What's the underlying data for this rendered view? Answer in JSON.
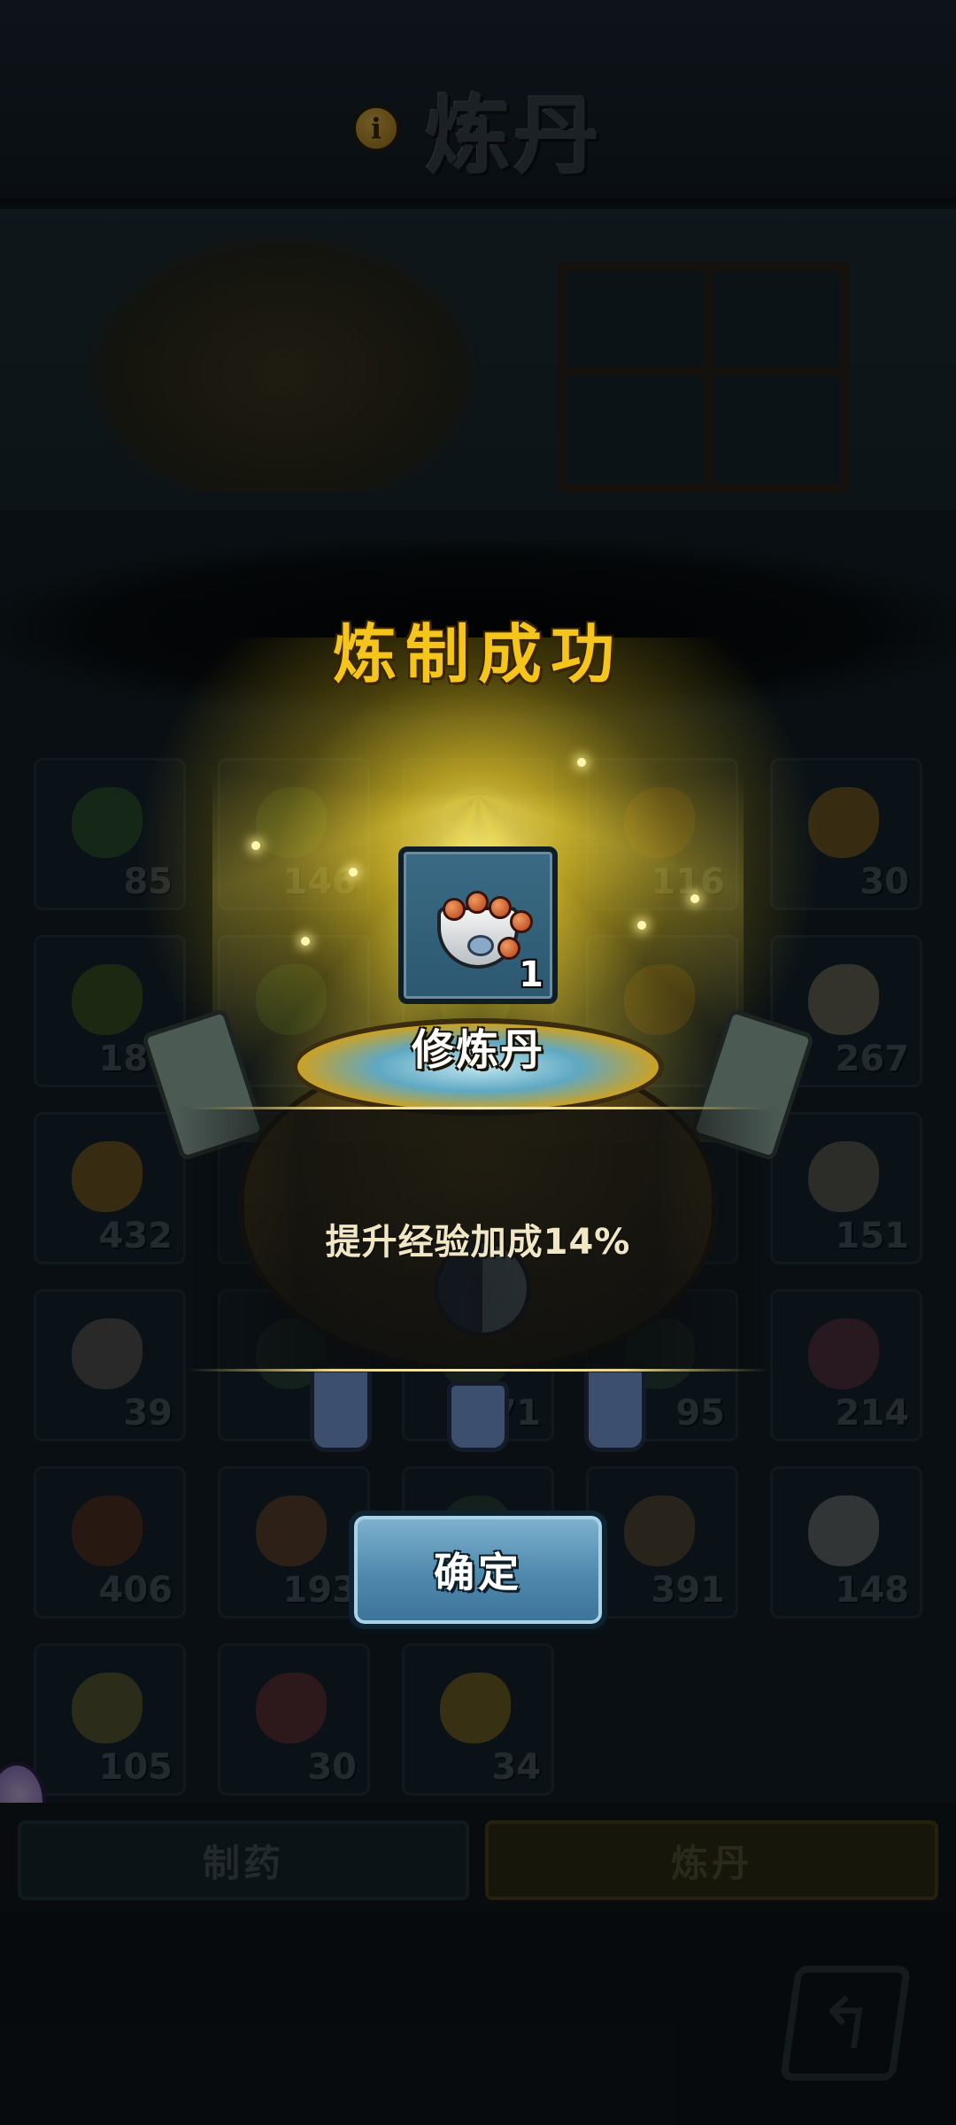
{
  "header": {
    "title": "炼丹",
    "info_icon": "info-icon",
    "info_glyph": "i"
  },
  "inventory": {
    "slots": [
      {
        "count": "85",
        "color": "#3f7a2a"
      },
      {
        "count": "146",
        "color": "#3c6a34"
      },
      {
        "count": "",
        "color": "#3a5a3a"
      },
      {
        "count": "116",
        "color": "#7a4a1a"
      },
      {
        "count": "30",
        "color": "#c68a18"
      },
      {
        "count": "188",
        "color": "#5e7a1a"
      },
      {
        "count": "",
        "color": "#3c6a34"
      },
      {
        "count": "",
        "color": "#3a5a3a"
      },
      {
        "count": "",
        "color": "#8a5a1a"
      },
      {
        "count": "267",
        "color": "#b8a880"
      },
      {
        "count": "432",
        "color": "#c68a18"
      },
      {
        "count": "",
        "color": "#3a5a3a"
      },
      {
        "count": "",
        "color": "#3a5a3a"
      },
      {
        "count": "",
        "color": "#3a5a3a"
      },
      {
        "count": "151",
        "color": "#9a8a70"
      },
      {
        "count": "39",
        "color": "#8a8070"
      },
      {
        "count": "",
        "color": "#3a5a3a"
      },
      {
        "count": "171",
        "color": "#3a5a3a"
      },
      {
        "count": "95",
        "color": "#3a5a3a"
      },
      {
        "count": "214",
        "color": "#8a4050"
      },
      {
        "count": "406",
        "color": "#8a3a1a"
      },
      {
        "count": "193",
        "color": "#9a5a2a"
      },
      {
        "count": "",
        "color": "#3a5a3a"
      },
      {
        "count": "391",
        "color": "#8a6a3a"
      },
      {
        "count": "148",
        "color": "#b0b0a8"
      },
      {
        "count": "105",
        "color": "#9a8a3a"
      },
      {
        "count": "30",
        "color": "#a03a3a"
      },
      {
        "count": "34",
        "color": "#c89a18"
      }
    ]
  },
  "tabs": {
    "left": "制药",
    "right": "炼丹"
  },
  "popup": {
    "title": "炼制成功",
    "item": {
      "name": "修炼丹",
      "count": "1",
      "icon": "pill-bowl-icon"
    },
    "effect": "提升经验加成14%",
    "confirm_label": "确定"
  },
  "colors": {
    "title_gold": "#f6c51b",
    "button_blue": "#4f89ad"
  }
}
